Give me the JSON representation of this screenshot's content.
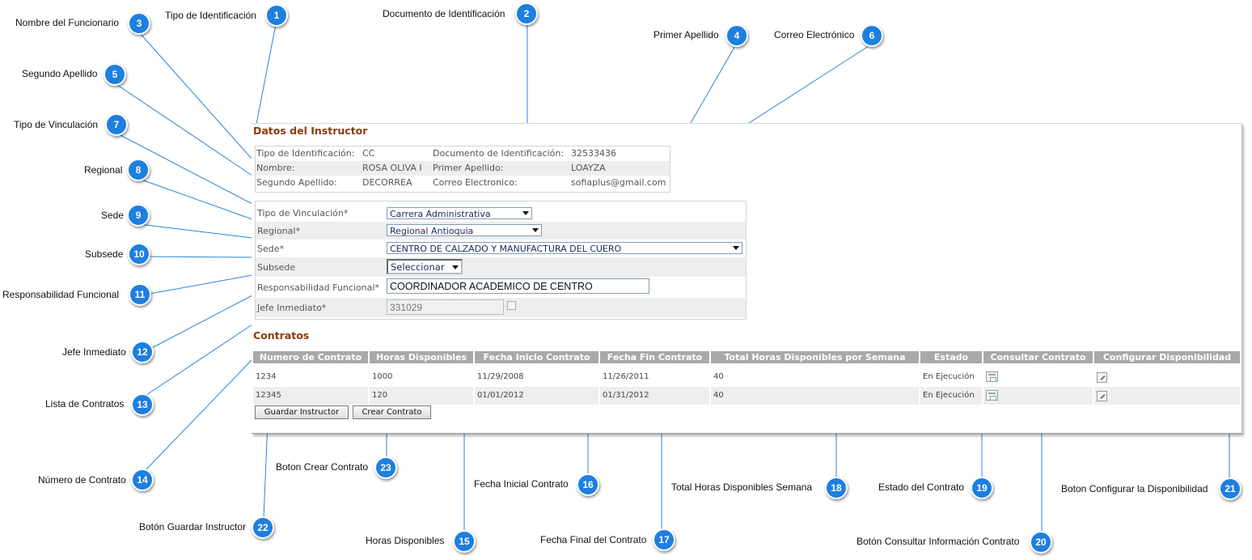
{
  "callouts": {
    "c1": {
      "number": "1",
      "label": "Tipo de Identificación"
    },
    "c2": {
      "number": "2",
      "label": "Documento de Identificación"
    },
    "c3": {
      "number": "3",
      "label": "Nombre del Funcionario"
    },
    "c4": {
      "number": "4",
      "label": "Primer Apellido"
    },
    "c5": {
      "number": "5",
      "label": "Segundo Apellido"
    },
    "c6": {
      "number": "6",
      "label": "Correo Electrónico"
    },
    "c7": {
      "number": "7",
      "label": "Tipo de Vinculación"
    },
    "c8": {
      "number": "8",
      "label": "Regional"
    },
    "c9": {
      "number": "9",
      "label": "Sede"
    },
    "c10": {
      "number": "10",
      "label": "Subsede"
    },
    "c11": {
      "number": "11",
      "label": "Responsabilidad Funcional"
    },
    "c12": {
      "number": "12",
      "label": "Jefe Inmediato"
    },
    "c13": {
      "number": "13",
      "label": "Lista de Contratos"
    },
    "c14": {
      "number": "14",
      "label": "Número de Contrato"
    },
    "c15": {
      "number": "15",
      "label": "Horas Disponibles"
    },
    "c16": {
      "number": "16",
      "label": "Fecha Inicial Contrato"
    },
    "c17": {
      "number": "17",
      "label": "Fecha Final del Contrato"
    },
    "c18": {
      "number": "18",
      "label": "Total Horas Disponibles Semana"
    },
    "c19": {
      "number": "19",
      "label": "Estado del Contrato"
    },
    "c20": {
      "number": "20",
      "label": "Botón Consultar Información Contrato"
    },
    "c21": {
      "number": "21",
      "label": "Boton Configurar la Disponibilidad"
    },
    "c22": {
      "number": "22",
      "label": "Botón Guardar Instructor"
    },
    "c23": {
      "number": "23",
      "label": "Boton Crear Contrato"
    }
  },
  "instructor": {
    "title": "Datos del Instructor",
    "tipo_label": "Tipo de Identificación:",
    "tipo_value": "CC",
    "doc_label": "Documento de Identificación:",
    "doc_value": "32533436",
    "nombre_label": "Nombre:",
    "nombre_value": "ROSA OLIVA I",
    "primer_label": "Primer Apellido:",
    "primer_value": "LOAYZA",
    "segundo_label": "Segundo Apellido:",
    "segundo_value": "DECORREA",
    "correo_label": "Correo Electronico:",
    "correo_value": "sofiaplus@gmail.com"
  },
  "form": {
    "vinculacion_label": "Tipo de Vinculación*",
    "vinculacion_value": "Carrera Administrativa",
    "regional_label": "Regional*",
    "regional_value": "Regional Antioquia",
    "sede_label": "Sede*",
    "sede_value": "CENTRO DE CALZADO Y MANUFACTURA DEL CUERO",
    "subsede_label": "Subsede",
    "subsede_value": "Seleccionar",
    "responsabilidad_label": "Responsabilidad Funcional*",
    "responsabilidad_value": "COORDINADOR ACADEMICO DE CENTRO",
    "jefe_label": "Jefe Inmediato*",
    "jefe_value": "331029"
  },
  "contratos": {
    "title": "Contratos",
    "headers": [
      "Numero de Contrato",
      "Horas Disponibles",
      "Fecha Inicio Contrato",
      "Fecha Fin Contrato",
      "Total Horas Disponibles por Semana",
      "Estado",
      "Consultar Contrato",
      "Configurar Disponibilidad"
    ],
    "rows": [
      {
        "numero": "1234",
        "horas": "1000",
        "inicio": "11/29/2008",
        "fin": "11/26/2011",
        "total": "40",
        "estado": "En Ejecución"
      },
      {
        "numero": "12345",
        "horas": "120",
        "inicio": "01/01/2012",
        "fin": "01/31/2012",
        "total": "40",
        "estado": "En Ejecución"
      }
    ]
  },
  "buttons": {
    "guardar": "Guardar Instructor",
    "crear": "Crear Contrato"
  },
  "colors": {
    "badge": "#1d7fe0",
    "line": "#2a86d6",
    "section_title": "#8b3a0a",
    "grid_header": "#a9a9a9"
  }
}
